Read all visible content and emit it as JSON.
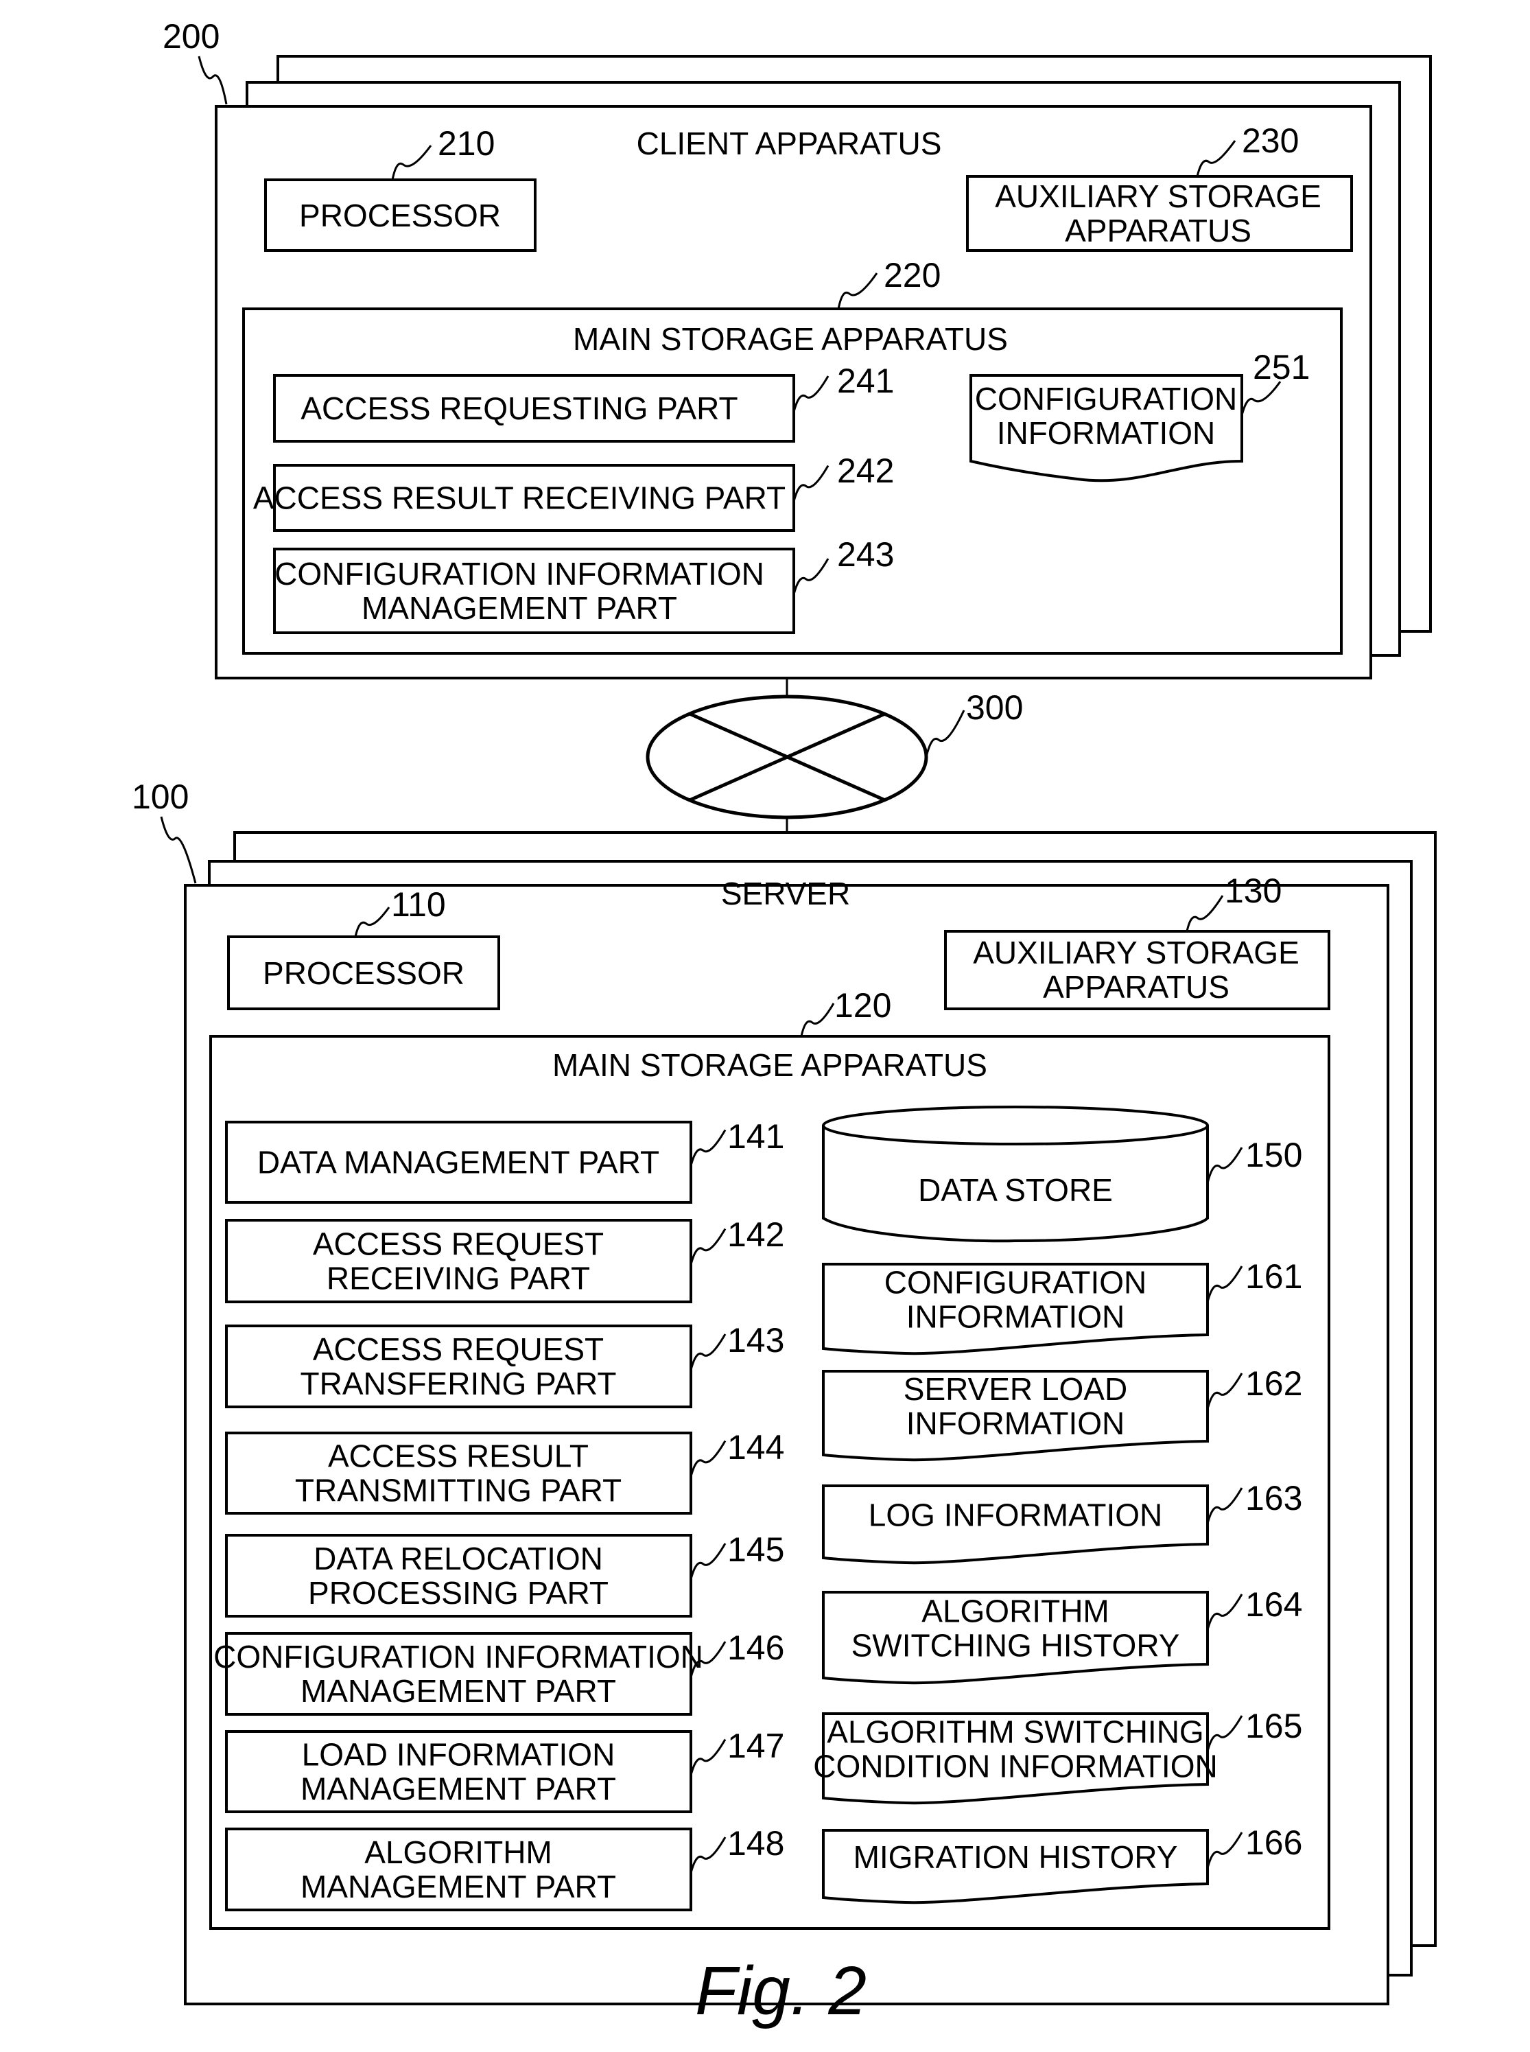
{
  "figure": {
    "caption": "Fig. 2",
    "client": {
      "ref": "200",
      "title": "CLIENT APPARATUS",
      "processor": {
        "ref": "210",
        "lines": [
          "PROCESSOR"
        ]
      },
      "auxiliary_storage": {
        "ref": "230",
        "lines": [
          "AUXILIARY STORAGE",
          "APPARATUS"
        ]
      },
      "main_storage": {
        "ref": "220",
        "title": "MAIN STORAGE APPARATUS",
        "parts": [
          {
            "ref": "241",
            "lines": [
              "ACCESS REQUESTING PART"
            ]
          },
          {
            "ref": "242",
            "lines": [
              "ACCESS RESULT RECEIVING PART"
            ]
          },
          {
            "ref": "243",
            "lines": [
              "CONFIGURATION INFORMATION",
              "MANAGEMENT PART"
            ]
          }
        ],
        "data": [
          {
            "ref": "251",
            "lines": [
              "CONFIGURATION",
              "INFORMATION"
            ]
          }
        ]
      }
    },
    "network": {
      "ref": "300"
    },
    "server": {
      "ref": "100",
      "title": "SERVER",
      "processor": {
        "ref": "110",
        "lines": [
          "PROCESSOR"
        ]
      },
      "auxiliary_storage": {
        "ref": "130",
        "lines": [
          "AUXILIARY STORAGE",
          "APPARATUS"
        ]
      },
      "main_storage": {
        "ref": "120",
        "title": "MAIN STORAGE APPARATUS",
        "parts": [
          {
            "ref": "141",
            "lines": [
              "DATA MANAGEMENT PART"
            ]
          },
          {
            "ref": "142",
            "lines": [
              "ACCESS REQUEST",
              "RECEIVING PART"
            ]
          },
          {
            "ref": "143",
            "lines": [
              "ACCESS REQUEST",
              "TRANSFERING PART"
            ]
          },
          {
            "ref": "144",
            "lines": [
              "ACCESS RESULT",
              "TRANSMITTING PART"
            ]
          },
          {
            "ref": "145",
            "lines": [
              "DATA RELOCATION",
              "PROCESSING PART"
            ]
          },
          {
            "ref": "146",
            "lines": [
              "CONFIGURATION INFORMATION",
              "MANAGEMENT PART"
            ]
          },
          {
            "ref": "147",
            "lines": [
              "LOAD INFORMATION",
              "MANAGEMENT PART"
            ]
          },
          {
            "ref": "148",
            "lines": [
              "ALGORITHM",
              "MANAGEMENT PART"
            ]
          }
        ],
        "data_store": {
          "ref": "150",
          "lines": [
            "DATA STORE"
          ]
        },
        "data": [
          {
            "ref": "161",
            "lines": [
              "CONFIGURATION",
              "INFORMATION"
            ]
          },
          {
            "ref": "162",
            "lines": [
              "SERVER LOAD",
              "INFORMATION"
            ]
          },
          {
            "ref": "163",
            "lines": [
              "LOG INFORMATION"
            ]
          },
          {
            "ref": "164",
            "lines": [
              "ALGORITHM",
              "SWITCHING HISTORY"
            ]
          },
          {
            "ref": "165",
            "lines": [
              "ALGORITHM SWITCHING",
              "CONDITION INFORMATION"
            ]
          },
          {
            "ref": "166",
            "lines": [
              "MIGRATION HISTORY"
            ]
          }
        ]
      }
    }
  }
}
